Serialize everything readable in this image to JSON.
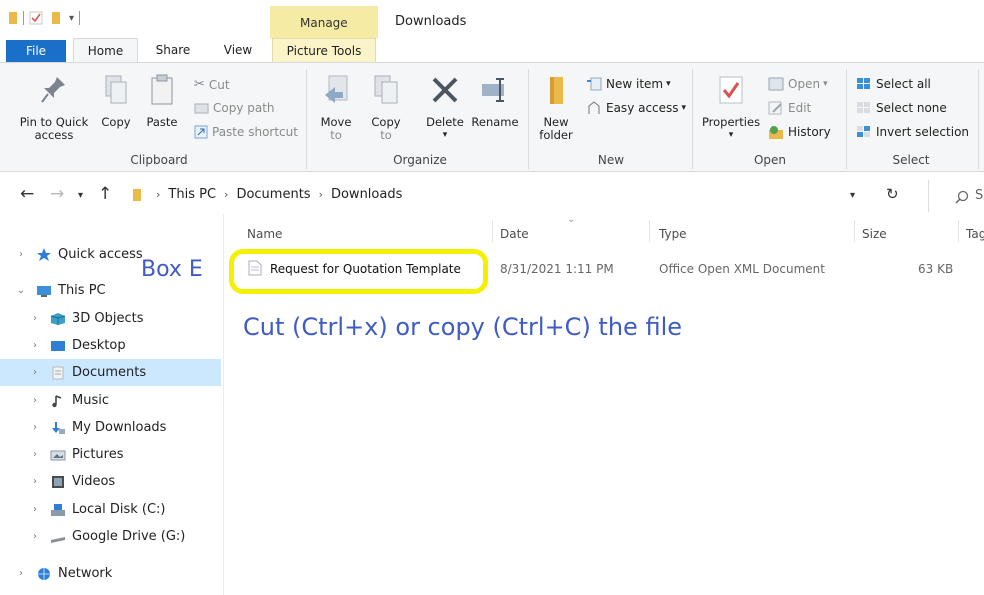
{
  "titlebar": {
    "context_tab": "Manage",
    "window_title": "Downloads"
  },
  "tabs": {
    "file": "File",
    "home": "Home",
    "share": "Share",
    "view": "View",
    "picture_tools": "Picture Tools"
  },
  "ribbon": {
    "clipboard": {
      "label": "Clipboard",
      "pin": "Pin to Quick access",
      "pin_line1": "Pin to Quick",
      "pin_line2": "access",
      "copy": "Copy",
      "paste": "Paste",
      "cut": "Cut",
      "copy_path": "Copy path",
      "paste_shortcut": "Paste shortcut"
    },
    "organize": {
      "label": "Organize",
      "move_to": "Move",
      "move_to_2": "to",
      "copy_to": "Copy",
      "copy_to_2": "to",
      "delete": "Delete",
      "rename": "Rename"
    },
    "new": {
      "label": "New",
      "new_folder": "New",
      "new_folder_2": "folder",
      "new_item": "New item",
      "easy_access": "Easy access"
    },
    "open": {
      "label": "Open",
      "properties": "Properties",
      "open": "Open",
      "edit": "Edit",
      "history": "History"
    },
    "select": {
      "label": "Select",
      "select_all": "Select all",
      "select_none": "Select none",
      "invert_selection": "Invert selection"
    }
  },
  "address": {
    "crumbs": [
      "This PC",
      "Documents",
      "Downloads"
    ],
    "search_placeholder": "Se"
  },
  "navpane": {
    "items": [
      {
        "label": "Quick access",
        "icon": "star-icon",
        "indent": 0
      },
      {
        "label": "This PC",
        "icon": "computer-icon",
        "indent": 0
      },
      {
        "label": "3D Objects",
        "icon": "cube-icon",
        "indent": 1
      },
      {
        "label": "Desktop",
        "icon": "desktop-icon",
        "indent": 1
      },
      {
        "label": "Documents",
        "icon": "documents-icon",
        "indent": 1
      },
      {
        "label": "Music",
        "icon": "music-icon",
        "indent": 1
      },
      {
        "label": "My Downloads",
        "icon": "download-icon",
        "indent": 1
      },
      {
        "label": "Pictures",
        "icon": "pictures-icon",
        "indent": 1
      },
      {
        "label": "Videos",
        "icon": "videos-icon",
        "indent": 1
      },
      {
        "label": "Local Disk (C:)",
        "icon": "disk-icon",
        "indent": 1
      },
      {
        "label": "Google Drive (G:)",
        "icon": "drive-icon",
        "indent": 1
      },
      {
        "label": "Network",
        "icon": "network-icon",
        "indent": 0
      }
    ],
    "selected": "Documents"
  },
  "filelist": {
    "columns": {
      "name": "Name",
      "date": "Date",
      "type": "Type",
      "size": "Size",
      "tags": "Tag"
    },
    "files": [
      {
        "name": "Request for Quotation Template",
        "date": "8/31/2021 1:11 PM",
        "type": "Office Open XML Document",
        "size": "63 KB"
      }
    ]
  },
  "annotation": {
    "box_label": "Box E",
    "instruction": "Cut (Ctrl+x) or copy (Ctrl+C) the file",
    "highlight_color": "#f5ef00",
    "text_color": "#3f5bc4"
  },
  "colors": {
    "file_tab": "#1a6fc9",
    "manage_bg": "#f6eba4",
    "selected_nav": "#cce8ff"
  }
}
